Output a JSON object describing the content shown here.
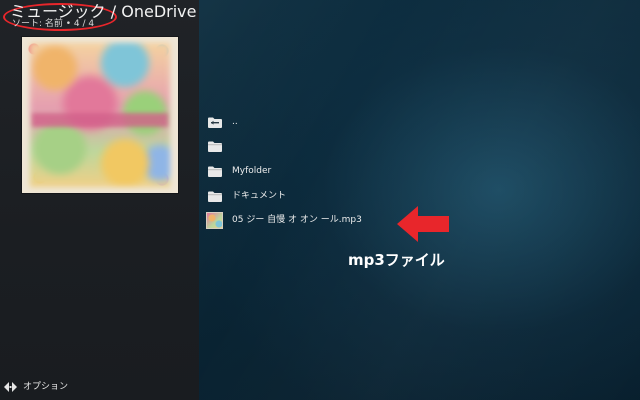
{
  "header": {
    "title": "ミュージック / OneDrive",
    "sort_info": "ソート: 名前 • 4 / 4"
  },
  "annotation": {
    "highlight_color": "#e8262b",
    "arrow_color": "#e8262b",
    "arrow_label": "mp3ファイル"
  },
  "files": {
    "items": [
      {
        "icon": "parent-folder-icon",
        "label": ".."
      },
      {
        "icon": "folder-icon",
        "label": ""
      },
      {
        "icon": "folder-icon",
        "label": "Myfolder"
      },
      {
        "icon": "folder-icon",
        "label": "ドキュメント"
      },
      {
        "icon": "album-art-icon",
        "label": "05 ジー 自慢 オ オン ール.mp3"
      }
    ]
  },
  "footer": {
    "options_label": "オプション",
    "options_icon": "options-arrows-icon"
  },
  "colors": {
    "accent": "#e8262b",
    "text": "#ececec"
  }
}
